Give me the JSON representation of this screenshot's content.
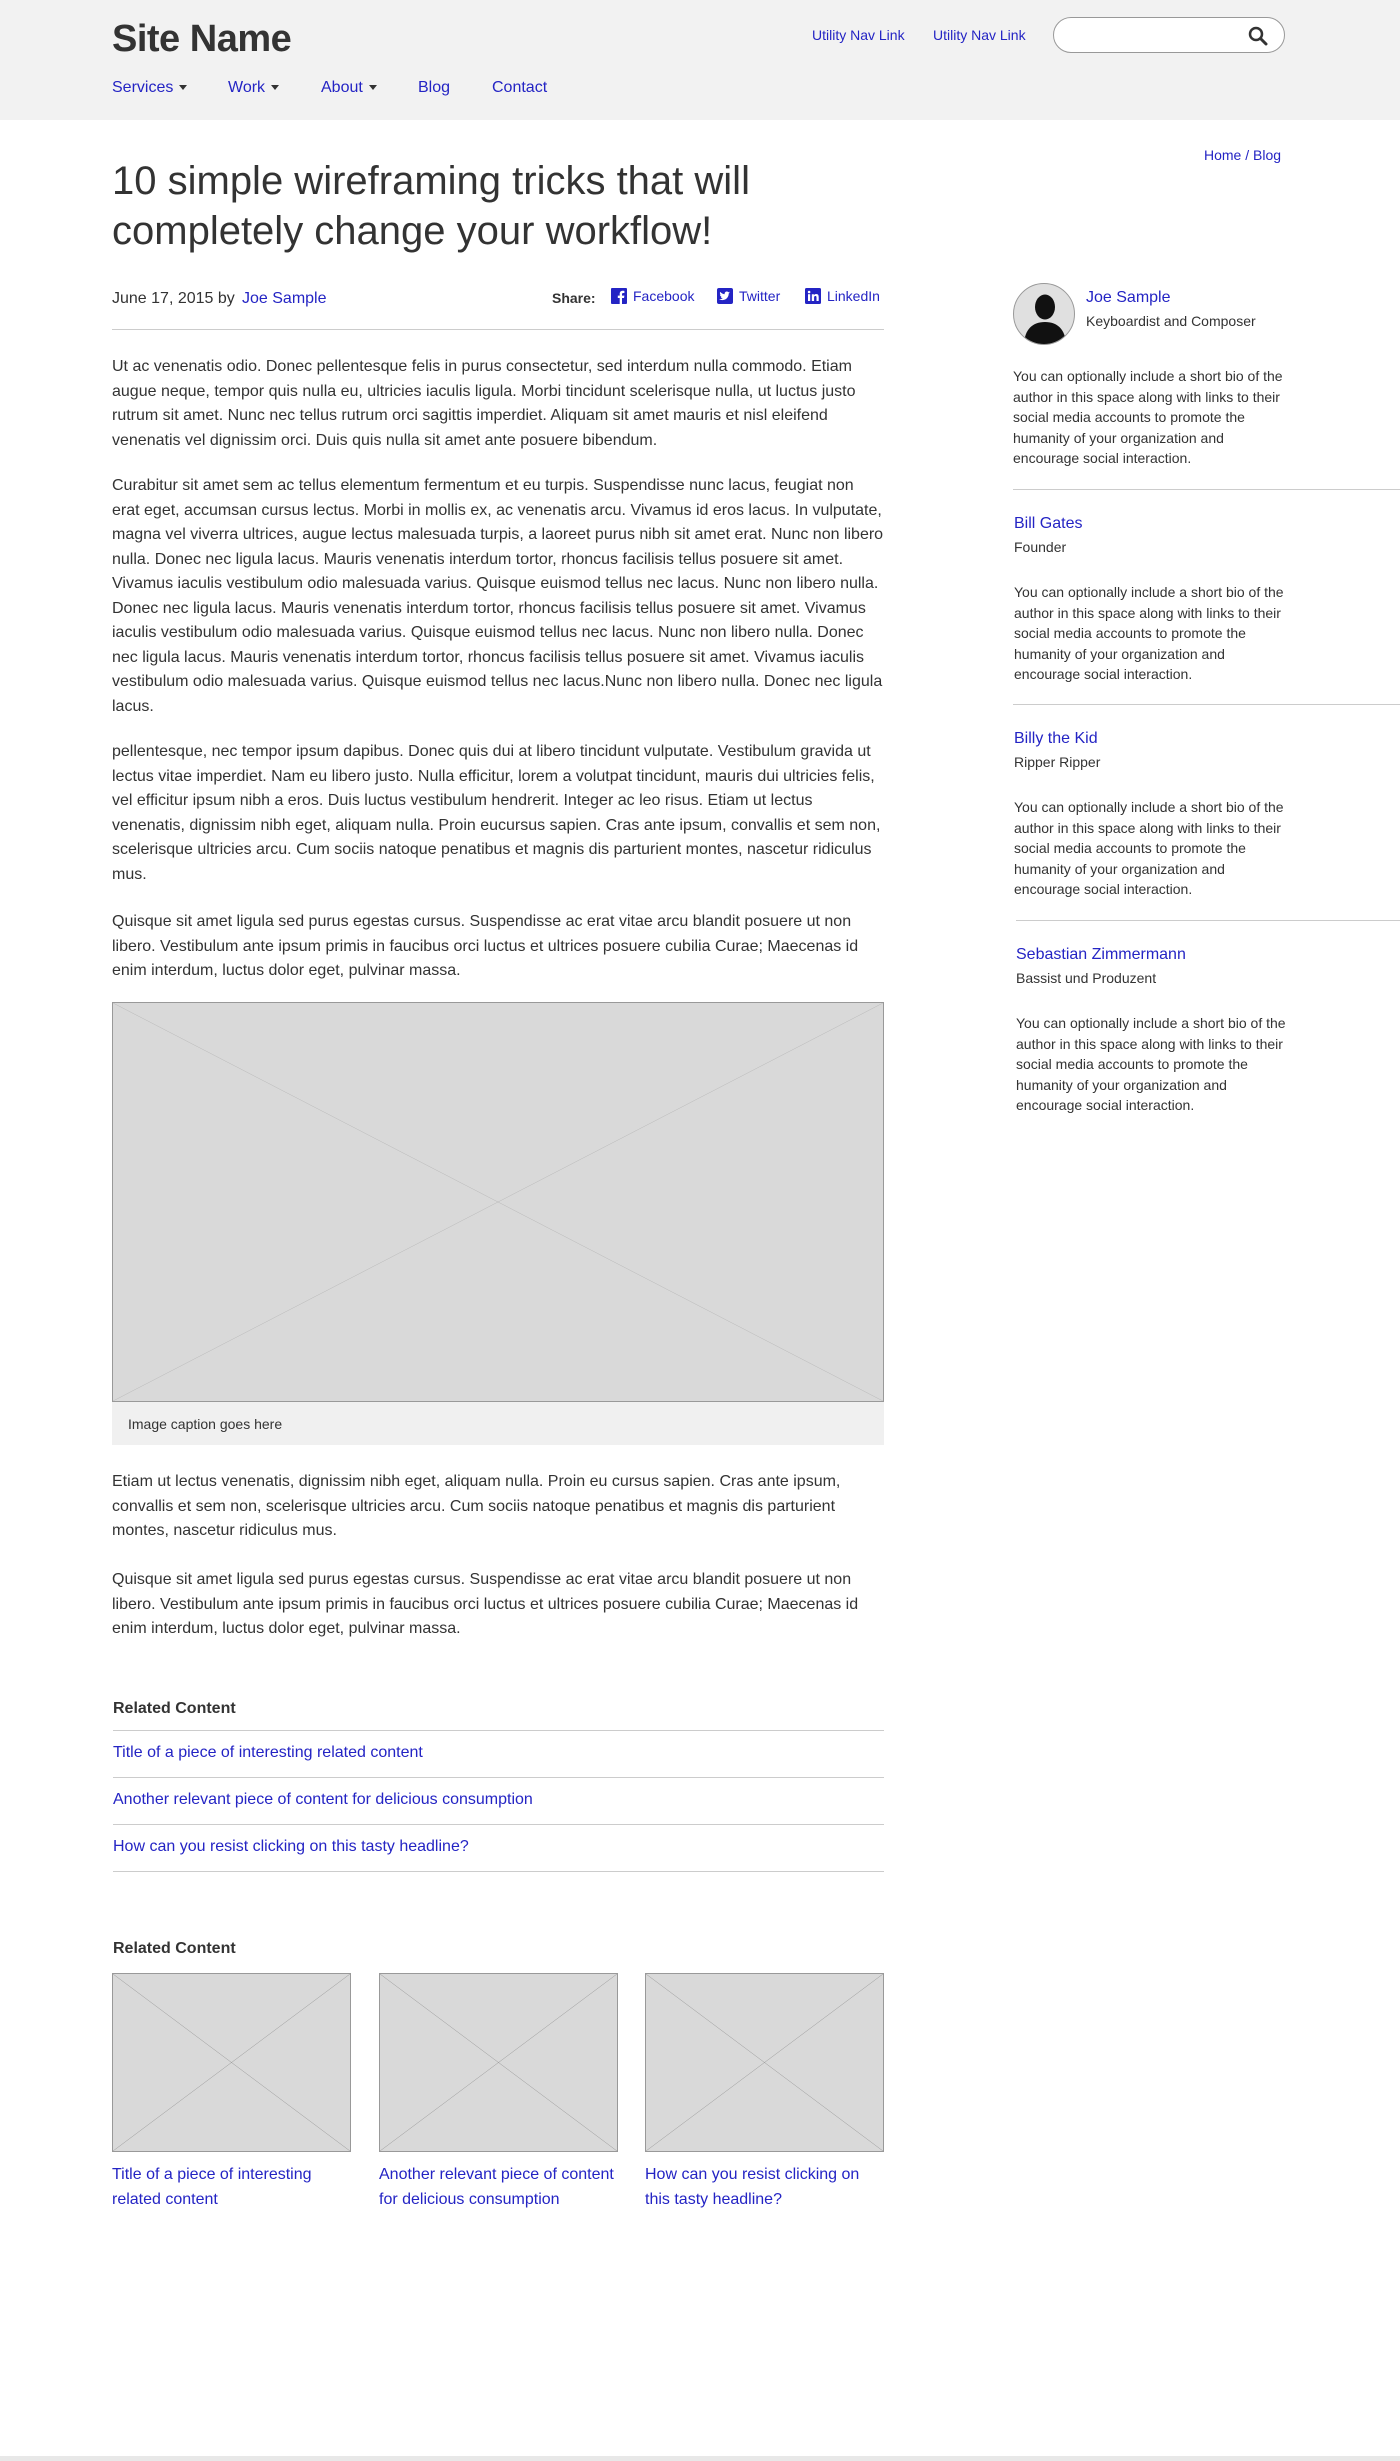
{
  "header": {
    "site_name": "Site Name",
    "utility_links": [
      "Utility Nav Link",
      "Utility Nav Link"
    ],
    "search_placeholder": "",
    "nav": [
      {
        "label": "Services",
        "has_dropdown": true
      },
      {
        "label": "Work",
        "has_dropdown": true
      },
      {
        "label": "About",
        "has_dropdown": true
      },
      {
        "label": "Blog",
        "has_dropdown": false
      },
      {
        "label": "Contact",
        "has_dropdown": false
      }
    ]
  },
  "breadcrumb": "Home / Blog",
  "article": {
    "title": "10 simple wireframing tricks that will completely change your workflow!",
    "date_by": "June 17, 2015 by",
    "author": "Joe Sample",
    "share_label": "Share:",
    "share": [
      "Facebook",
      "Twitter",
      "LinkedIn"
    ],
    "paragraphs": [
      "Ut ac venenatis odio. Donec pellentesque felis in purus consectetur, sed interdum nulla commodo. Etiam augue neque, tempor quis nulla eu, ultricies iaculis ligula. Morbi tincidunt scelerisque nulla, ut luctus justo rutrum sit amet. Nunc nec tellus rutrum orci sagittis imperdiet. Aliquam sit amet mauris et nisl eleifend venenatis vel dignissim orci. Duis quis nulla sit amet ante posuere bibendum.",
      "Curabitur sit amet sem ac tellus elementum fermentum et eu turpis. Suspendisse nunc lacus, feugiat non erat eget, accumsan cursus lectus. Morbi in mollis ex, ac venenatis arcu. Vivamus id eros lacus. In vulputate, magna vel viverra ultrices, augue lectus malesuada turpis, a laoreet purus nibh sit amet erat. Nunc non libero nulla. Donec nec ligula lacus. Mauris venenatis interdum tortor, rhoncus facilisis tellus posuere sit amet. Vivamus iaculis vestibulum odio malesuada varius. Quisque euismod tellus nec lacus. Nunc non libero nulla. Donec nec ligula lacus. Mauris venenatis interdum tortor, rhoncus facilisis tellus posuere sit amet. Vivamus iaculis vestibulum odio malesuada varius. Quisque euismod tellus nec lacus. Nunc non libero nulla. Donec nec ligula lacus. Mauris venenatis interdum tortor, rhoncus facilisis tellus posuere sit amet. Vivamus iaculis vestibulum odio malesuada varius. Quisque euismod tellus nec lacus.Nunc non libero nulla. Donec nec ligula lacus.",
      "pellentesque, nec tempor ipsum dapibus. Donec quis dui at libero tincidunt vulputate. Vestibulum gravida ut lectus vitae imperdiet. Nam eu libero justo. Nulla efficitur, lorem a volutpat tincidunt, mauris dui ultricies felis, vel efficitur ipsum nibh a eros. Duis luctus vestibulum hendrerit. Integer ac leo risus. Etiam ut lectus venenatis, dignissim nibh eget, aliquam nulla. Proin eucursus sapien. Cras ante ipsum, convallis et sem non, scelerisque ultricies arcu. Cum sociis natoque penatibus et magnis dis parturient montes, nascetur ridiculus mus.",
      "Quisque sit amet ligula sed purus egestas cursus. Suspendisse ac erat vitae arcu blandit posuere ut non libero. Vestibulum ante ipsum primis in faucibus orci luctus et ultrices posuere cubilia Curae; Maecenas id enim interdum, luctus dolor eget, pulvinar massa.",
      "Etiam ut lectus venenatis, dignissim nibh eget, aliquam nulla. Proin eu cursus sapien. Cras ante ipsum, convallis et sem non, scelerisque ultricies arcu. Cum sociis natoque penatibus et magnis dis parturient montes, nascetur ridiculus mus.",
      "Quisque sit amet ligula sed purus egestas cursus. Suspendisse ac erat vitae arcu blandit posuere ut non libero. Vestibulum ante ipsum primis in faucibus orci luctus et ultrices posuere cubilia Curae; Maecenas id enim interdum, luctus dolor eget, pulvinar massa."
    ],
    "image_caption": "Image caption goes here"
  },
  "related_list": {
    "title": "Related Content",
    "items": [
      "Title of a piece of interesting related content",
      "Another relevant piece of content for delicious consumption",
      "How can you resist clicking on this tasty headline?"
    ]
  },
  "related_cards": {
    "title": "Related Content",
    "items": [
      "Title of a piece of interesting related content",
      "Another relevant piece of content for delicious consumption",
      "How can you resist clicking on this tasty headline?"
    ]
  },
  "authors": [
    {
      "name": "Joe Sample",
      "role": "Keyboardist and Composer",
      "bio": "You can optionally include a short bio of the author in this space along with links to their social media accounts to promote the humanity of your organization and encourage social interaction."
    },
    {
      "name": "Bill Gates",
      "role": "Founder",
      "bio": "You can optionally include a short bio of the author in this space along with links to their social media accounts to promote the humanity of your organization and encourage social interaction."
    },
    {
      "name": "Billy the Kid",
      "role": "Ripper Ripper",
      "bio": "You can optionally include a short bio of the author in this space along with links to their social media accounts to promote the humanity of your organization and encourage social interaction."
    },
    {
      "name": "Sebastian Zimmermann",
      "role": "Bassist und Produzent",
      "bio": "You can optionally include a short bio of the author in this space along with links to their social media accounts to promote the humanity of your organization and encourage social interaction."
    }
  ],
  "colors": {
    "link": "#2424c4",
    "header_bg": "#f2f2f2",
    "placeholder_bg": "#d9d9d9",
    "text": "#333333"
  }
}
